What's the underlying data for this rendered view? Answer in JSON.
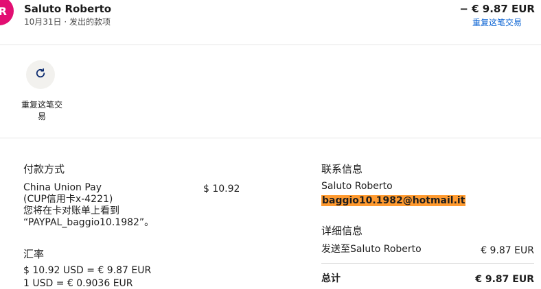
{
  "header": {
    "avatar_initial": "R",
    "name": "Saluto Roberto",
    "subtitle": "10月31日 · 发出的款项",
    "amount": "− € 9.87 EUR",
    "repeat_link": "重复这笔交易"
  },
  "actions": {
    "repeat_icon": "refresh-icon",
    "repeat_label_line1": "重复这笔交",
    "repeat_label_line2": "易"
  },
  "payment": {
    "title": "付款方式",
    "method_line1": "China Union Pay",
    "method_line2": "(CUP信用卡x-4221)",
    "method_line3": "您将在卡对账单上看到",
    "method_line4": "“PAYPAL_baggio10.1982”。",
    "amount": "$ 10.92"
  },
  "exchange": {
    "title": "汇率",
    "line1": "$ 10.92 USD = € 9.87 EUR",
    "line2": "1 USD = € 0.9036 EUR"
  },
  "contact": {
    "title": "联系信息",
    "name": "Saluto Roberto",
    "email": "baggio10.1982@hotmail.it"
  },
  "details": {
    "title": "详细信息",
    "sent_to_label": "发送至Saluto Roberto",
    "sent_to_amount": "€ 9.87 EUR",
    "total_label": "总计",
    "total_amount": "€ 9.87 EUR"
  },
  "colors": {
    "avatar": "#e20e72",
    "link": "#0a63d3",
    "email_highlight": "#ff9a2f"
  }
}
